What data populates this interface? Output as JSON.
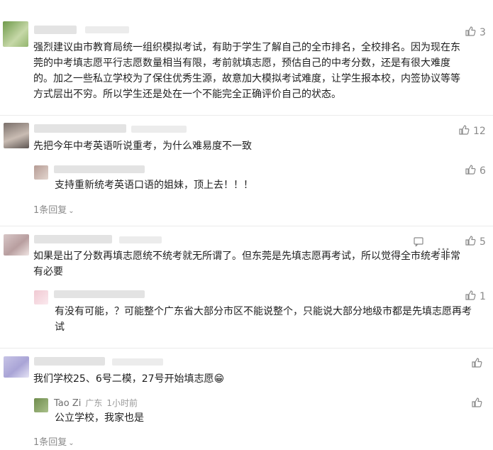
{
  "comments": [
    {
      "likes": "3",
      "text": "强烈建议由市教育局统一组织模拟考试，有助于学生了解自己的全市排名，全校排名。因为现在东莞的中考填志愿平行志愿数量相当有限，考前就填志愿，预估自己的中考分数，还是有很大难度的。加之一些私立学校为了保住优秀生源，故意加大模拟考试难度，让学生报本校，内签协议等等方式层出不穷。所以学生还是处在一个不能完全正确评价自己的状态。"
    },
    {
      "likes": "12",
      "text": "先把今年中考英语听说重考，为什么难易度不一致",
      "reply": {
        "likes": "6",
        "text": "支持重新统考英语口语的姐妹，顶上去！！！"
      },
      "reply_count": "1条回复"
    },
    {
      "likes": "5",
      "text": "如果是出了分数再填志愿统不统考就无所谓了。但东莞是先填志愿再考试，所以觉得全市统考非常有必要",
      "reply": {
        "likes": "1",
        "text": "有没有可能，？可能整个广东省大部分市区不能说整个，只能说大部分地级市都是先填志愿再考试"
      }
    },
    {
      "text": "我们学校25、6号二模，27号开始填志愿",
      "emoji": "😁",
      "reply": {
        "author": "Tao Zi",
        "location": "广东",
        "time": "1小时前",
        "text": "公立学校，我家也是"
      },
      "reply_count": "1条回复"
    }
  ],
  "colors": {
    "text": "#1f1f1f",
    "muted": "#8a8a8a",
    "divider": "#ebebeb"
  },
  "icons": [
    "thumbs-up-icon",
    "comment-icon",
    "more-icon",
    "chevron-down-icon"
  ]
}
